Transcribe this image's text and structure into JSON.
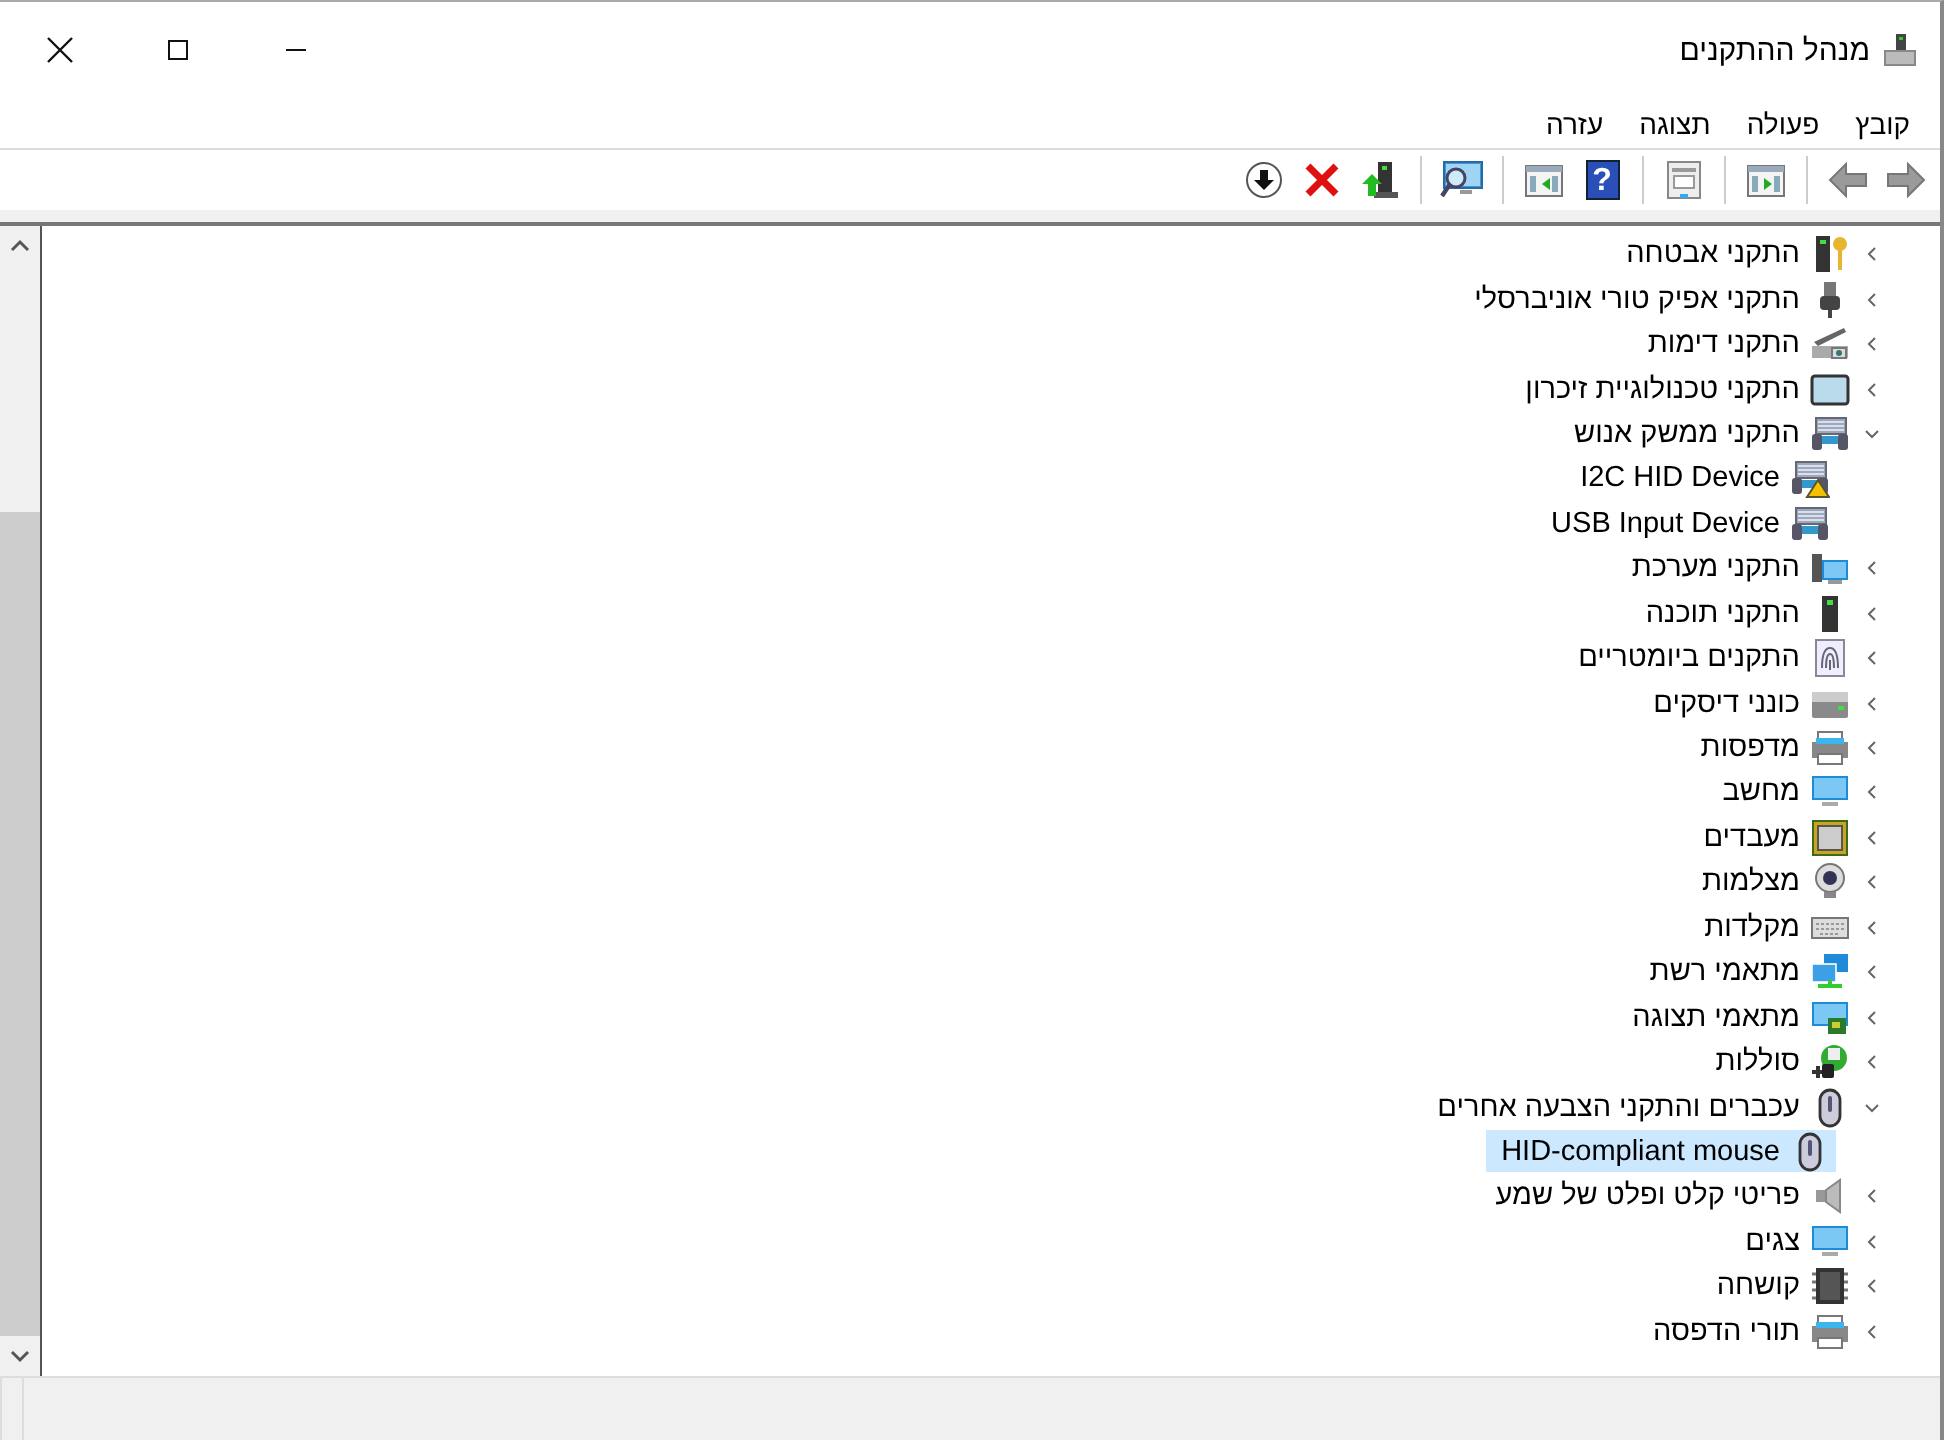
{
  "window": {
    "title": "מנהל ההתקנים"
  },
  "menu": [
    {
      "label": "קובץ"
    },
    {
      "label": "פעולה"
    },
    {
      "label": "תצוגה"
    },
    {
      "label": "עזרה"
    }
  ],
  "toolbar": [
    [
      {
        "kind": "back",
        "disabled": true
      },
      {
        "kind": "forward",
        "disabled": true
      }
    ],
    [
      {
        "kind": "showhide"
      }
    ],
    [
      {
        "kind": "properties"
      }
    ],
    [
      {
        "kind": "help",
        "glyph": "?"
      },
      {
        "kind": "view"
      }
    ],
    [
      {
        "kind": "scan"
      }
    ],
    [
      {
        "kind": "update"
      },
      {
        "kind": "uninstall"
      },
      {
        "kind": "enable"
      }
    ]
  ],
  "tree": [
    {
      "label": "התקני אבטחה",
      "kind": "security",
      "expanded": false,
      "selected": false
    },
    {
      "label": "התקני אפיק טורי אוניברסלי",
      "kind": "usb",
      "expanded": false,
      "selected": false
    },
    {
      "label": "התקני דימות",
      "kind": "imaging",
      "expanded": false,
      "selected": false
    },
    {
      "label": "התקני טכנולוגיית זיכרון",
      "kind": "memory",
      "expanded": false,
      "selected": false
    },
    {
      "label": "התקני ממשק אנוש",
      "kind": "hid",
      "expanded": true,
      "selected": false,
      "children": [
        {
          "label": "I2C HID Device",
          "kind": "hid",
          "warning": true,
          "selected": false
        },
        {
          "label": "USB Input Device",
          "kind": "hid",
          "warning": false,
          "selected": false
        }
      ]
    },
    {
      "label": "התקני מערכת",
      "kind": "system",
      "expanded": false,
      "selected": false
    },
    {
      "label": "התקני תוכנה",
      "kind": "software",
      "expanded": false,
      "selected": false
    },
    {
      "label": "התקנים ביומטריים",
      "kind": "biometric",
      "expanded": false,
      "selected": false
    },
    {
      "label": "כונני דיסקים",
      "kind": "disk",
      "expanded": false,
      "selected": false
    },
    {
      "label": "מדפסות",
      "kind": "printer",
      "expanded": false,
      "selected": false
    },
    {
      "label": "מחשב",
      "kind": "monitor",
      "expanded": false,
      "selected": false
    },
    {
      "label": "מעבדים",
      "kind": "processor",
      "expanded": false,
      "selected": false
    },
    {
      "label": "מצלמות",
      "kind": "webcam",
      "expanded": false,
      "selected": false
    },
    {
      "label": "מקלדות",
      "kind": "keyboard",
      "expanded": false,
      "selected": false
    },
    {
      "label": "מתאמי רשת",
      "kind": "network",
      "expanded": false,
      "selected": false
    },
    {
      "label": "מתאמי תצוגה",
      "kind": "display",
      "expanded": false,
      "selected": false
    },
    {
      "label": "סוללות",
      "kind": "battery",
      "expanded": false,
      "selected": false
    },
    {
      "label": "עכברים והתקני הצבעה אחרים",
      "kind": "mouse",
      "expanded": true,
      "selected": false,
      "children": [
        {
          "label": "HID-compliant mouse",
          "kind": "mouse",
          "warning": false,
          "selected": true
        }
      ]
    },
    {
      "label": "פריטי קלט ופלט של שמע",
      "kind": "speaker",
      "expanded": false,
      "selected": false
    },
    {
      "label": "צגים",
      "kind": "monitor",
      "expanded": false,
      "selected": false
    },
    {
      "label": "קושחה",
      "kind": "firmware",
      "expanded": false,
      "selected": false
    },
    {
      "label": "תורי הדפסה",
      "kind": "printer",
      "expanded": false,
      "selected": false
    }
  ]
}
